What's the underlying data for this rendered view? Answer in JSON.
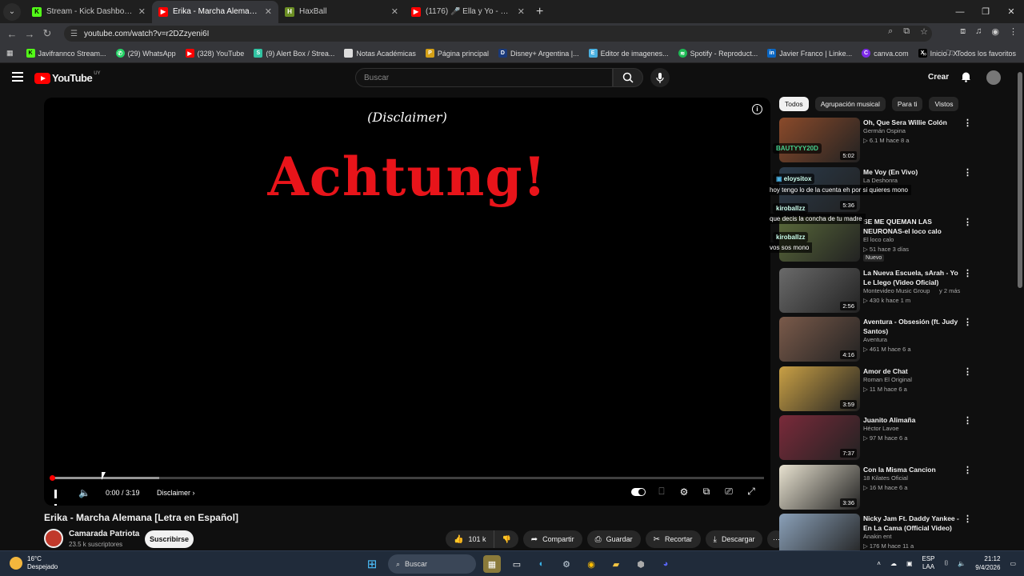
{
  "browser": {
    "tabs": [
      {
        "title": "Stream - Kick Dashboard",
        "favicon_color": "#53fc18",
        "favicon_letter": "K",
        "active": false
      },
      {
        "title": "Erika - Marcha Alemana [Letra e",
        "favicon_color": "#ff0000",
        "favicon_letter": "▶",
        "active": true
      },
      {
        "title": "HaxBall",
        "favicon_color": "#6b8e23",
        "favicon_letter": "H",
        "active": false
      },
      {
        "title": "(1176) 🎤 Ella y Yo - Don Omar",
        "favicon_color": "#ff0000",
        "favicon_letter": "▶",
        "active": false
      }
    ],
    "new_tab": "+",
    "url": "youtube.com/watch?v=r2DZzyeni6I",
    "bookmarks": [
      {
        "label": "Javifrannco Stream...",
        "color": "#53fc18",
        "letter": "K"
      },
      {
        "label": "(29) WhatsApp",
        "color": "#25d366",
        "letter": "W"
      },
      {
        "label": "(328) YouTube",
        "color": "#ff0000",
        "letter": "▶"
      },
      {
        "label": "(9) Alert Box / Strea...",
        "color": "#31c3a2",
        "letter": "S"
      },
      {
        "label": "Notas Académicas",
        "color": "#cccccc",
        "letter": ""
      },
      {
        "label": "Página principal",
        "color": "#d4a017",
        "letter": "P"
      },
      {
        "label": "Disney+ Argentina |...",
        "color": "#1a3a7a",
        "letter": "D"
      },
      {
        "label": "Editor de imagenes...",
        "color": "#4ab0e0",
        "letter": "E"
      },
      {
        "label": "Spotify - Reproduct...",
        "color": "#1db954",
        "letter": "S"
      },
      {
        "label": "Javier Franco | Linke...",
        "color": "#0a66c2",
        "letter": "in"
      },
      {
        "label": "canva.com",
        "color": "#7d2ae8",
        "letter": "C"
      },
      {
        "label": "Inicio / X",
        "color": "#000000",
        "letter": "X"
      }
    ],
    "bookmarks_overflow": "»",
    "all_bookmarks": "Todos los favoritos"
  },
  "youtube": {
    "logo": "YouTube",
    "region": "UY",
    "search_placeholder": "Buscar",
    "create": "Crear",
    "video": {
      "overlay_top": "(Disclaimer)",
      "overlay_main": "Achtung!",
      "time": "0:00 / 3:19",
      "chapter": "Disclaimer",
      "chapter_arrow": "›",
      "buffered_fraction": 0.15,
      "played_fraction": 0.0,
      "title": "Erika - Marcha Alemana [Letra en Español]",
      "channel": "Camarada Patriota",
      "subscribers": "23.5 k suscriptores",
      "subscribe": "Suscribirse",
      "likes": "101 k",
      "share": "Compartir",
      "save": "Guardar",
      "clip": "Recortar",
      "download": "Descargar"
    },
    "chips": [
      "Todos",
      "Agrupación musical",
      "Para ti",
      "Vistos"
    ],
    "recommendations": [
      {
        "title": "Oh, Que Sera   Willie Colón",
        "channel": "Germán Ospina",
        "meta": "▷ 6.1 M  hace 8 a",
        "duration": "5:02",
        "thumb": "#8a4a2a"
      },
      {
        "title": "Me Voy (En Vivo)",
        "channel": "La Deshonra",
        "meta": "",
        "duration": "5:36",
        "thumb": "#2a3a4a"
      },
      {
        "title": "SE ME QUEMAN LAS NEURONAS-el loco calo",
        "channel": "El loco calo",
        "meta": "▷ 51  hace 3 días",
        "duration": "",
        "thumb": "#5a6a3a"
      },
      {
        "title": "La Nueva Escuela, sArah - Yo Le Llego (Video Oficial)",
        "channel": "Montevideo Music Group",
        "meta": "▷ 430 k  hace 1 m",
        "duration": "2:56",
        "thumb": "#6a6a6a"
      },
      {
        "title": "Aventura - Obsesión (ft. Judy Santos)",
        "channel": "Aventura",
        "meta": "▷ 461 M  hace 6 a",
        "duration": "4:16",
        "thumb": "#7a5a4a"
      },
      {
        "title": "Amor de Chat",
        "channel": "Roman El Original",
        "meta": "▷ 11 M  hace 6 a",
        "duration": "3:59",
        "thumb": "#c9a045"
      },
      {
        "title": "Juanito Alimaña",
        "channel": "Héctor Lavoe",
        "meta": "▷ 97 M  hace 6 a",
        "duration": "7:37",
        "thumb": "#7a2a3a"
      },
      {
        "title": "Con la Misma Cancion",
        "channel": "18 Kilates Oficial",
        "meta": "▷ 16 M  hace 6 a",
        "duration": "3:36",
        "thumb": "#e8e2d0"
      },
      {
        "title": "Nicky Jam Ft. Daddy Yankee - En La Cama (Official Video)",
        "channel": "Anakin ent",
        "meta": "▷ 176 M  hace 11 a",
        "duration": "",
        "thumb": "#8aa0b8"
      }
    ],
    "recommendation_extra": {
      "montevideo_suffix": "y 2 más",
      "nuevo": "Nuevo"
    }
  },
  "chat_overlay": [
    {
      "user": "BAUTYYY20D",
      "msg": ""
    },
    {
      "user": "eloysitox",
      "msg": "hoy tengo lo de la cuenta eh por si quieres mono"
    },
    {
      "user": "kiroballzz",
      "msg": "que decis la concha de tu madre"
    },
    {
      "user": "kiroballzz",
      "msg": "vos sos mono"
    }
  ],
  "taskbar": {
    "temp": "16°C",
    "weather": "Despejado",
    "search": "Buscar",
    "lang1": "ESP",
    "lang2": "LAA",
    "time": "21:12",
    "date": "9/4/2026"
  }
}
